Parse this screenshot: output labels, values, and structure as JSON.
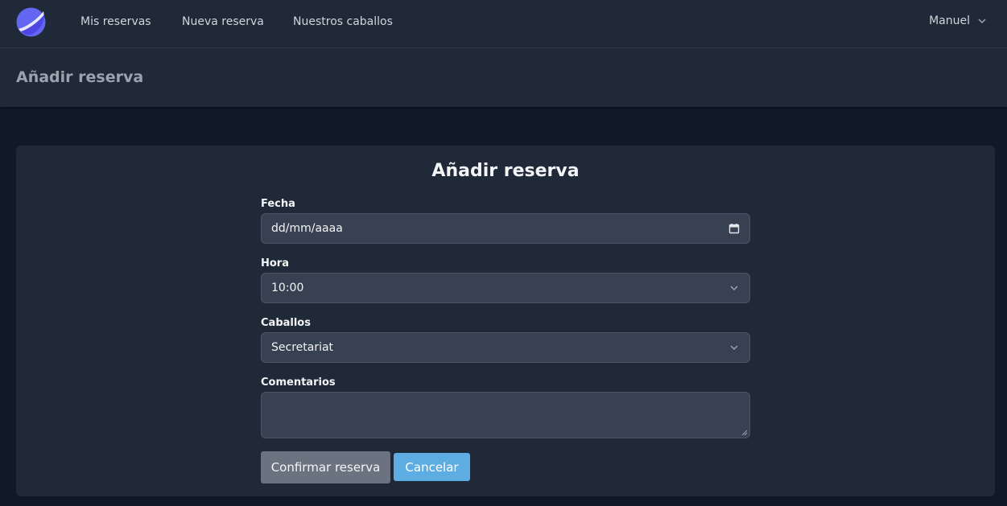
{
  "nav": {
    "links": [
      "Mis reservas",
      "Nueva reserva",
      "Nuestros caballos"
    ],
    "user": "Manuel"
  },
  "header": {
    "title": "Añadir reserva"
  },
  "form": {
    "title": "Añadir reserva",
    "date_label": "Fecha",
    "date_value": "dd/mm/aaaa",
    "time_label": "Hora",
    "time_value": "10:00",
    "horse_label": "Caballos",
    "horse_value": "Secretariat",
    "comments_label": "Comentarios",
    "comments_value": "",
    "confirm_label": "Confirmar reserva",
    "cancel_label": "Cancelar"
  },
  "colors": {
    "background": "#111827",
    "surface": "#1f2937",
    "input": "#374151",
    "logo": "#6366f1",
    "confirm": "#6b7280",
    "cancel": "#5dade2"
  },
  "icons": [
    "logo-icon",
    "chevron-down-icon",
    "calendar-icon"
  ]
}
